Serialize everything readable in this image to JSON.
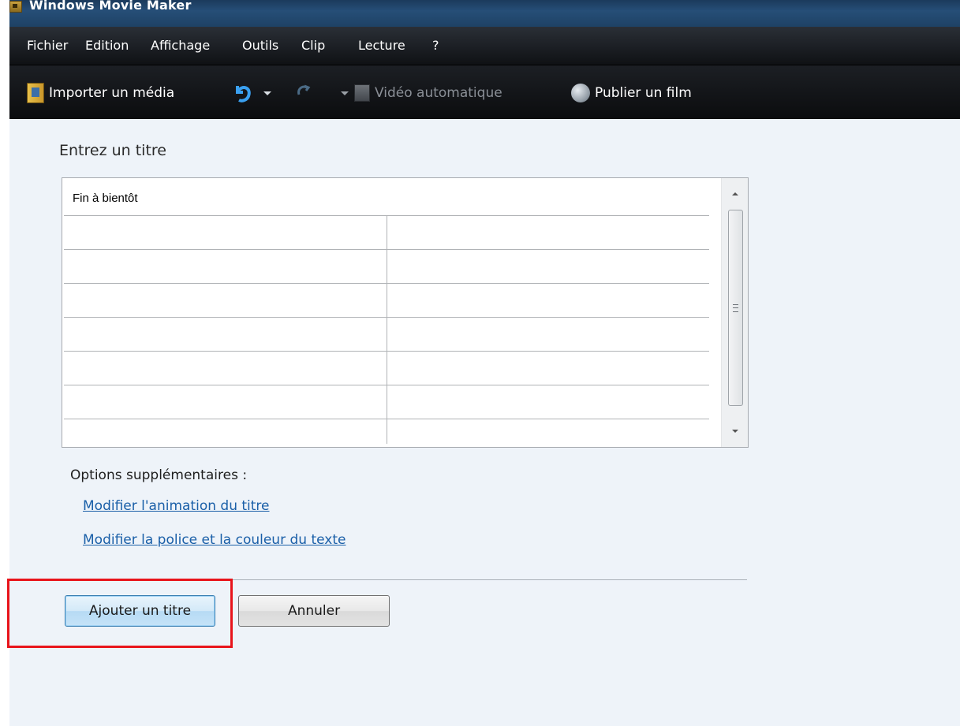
{
  "window": {
    "title": "Windows Movie Maker"
  },
  "menu": [
    "Fichier",
    "Edition",
    "Affichage",
    "Outils",
    "Clip",
    "Lecture",
    "?"
  ],
  "toolbar": {
    "import_label": "Importer un média",
    "auto_video_label": "Vidéo automatique",
    "publish_label": "Publier un film"
  },
  "dialog": {
    "prompt": "Entrez un titre",
    "title_text": "Fin à bientôt",
    "options_label": "Options supplémentaires :",
    "links": [
      "Modifier l'animation du titre",
      "Modifier la police et la couleur du texte"
    ],
    "add_button": "Ajouter un titre",
    "cancel_button": "Annuler"
  },
  "colors": {
    "link": "#1a5fa8",
    "highlight": "#e8141b",
    "accent": "#3c7fb1"
  }
}
